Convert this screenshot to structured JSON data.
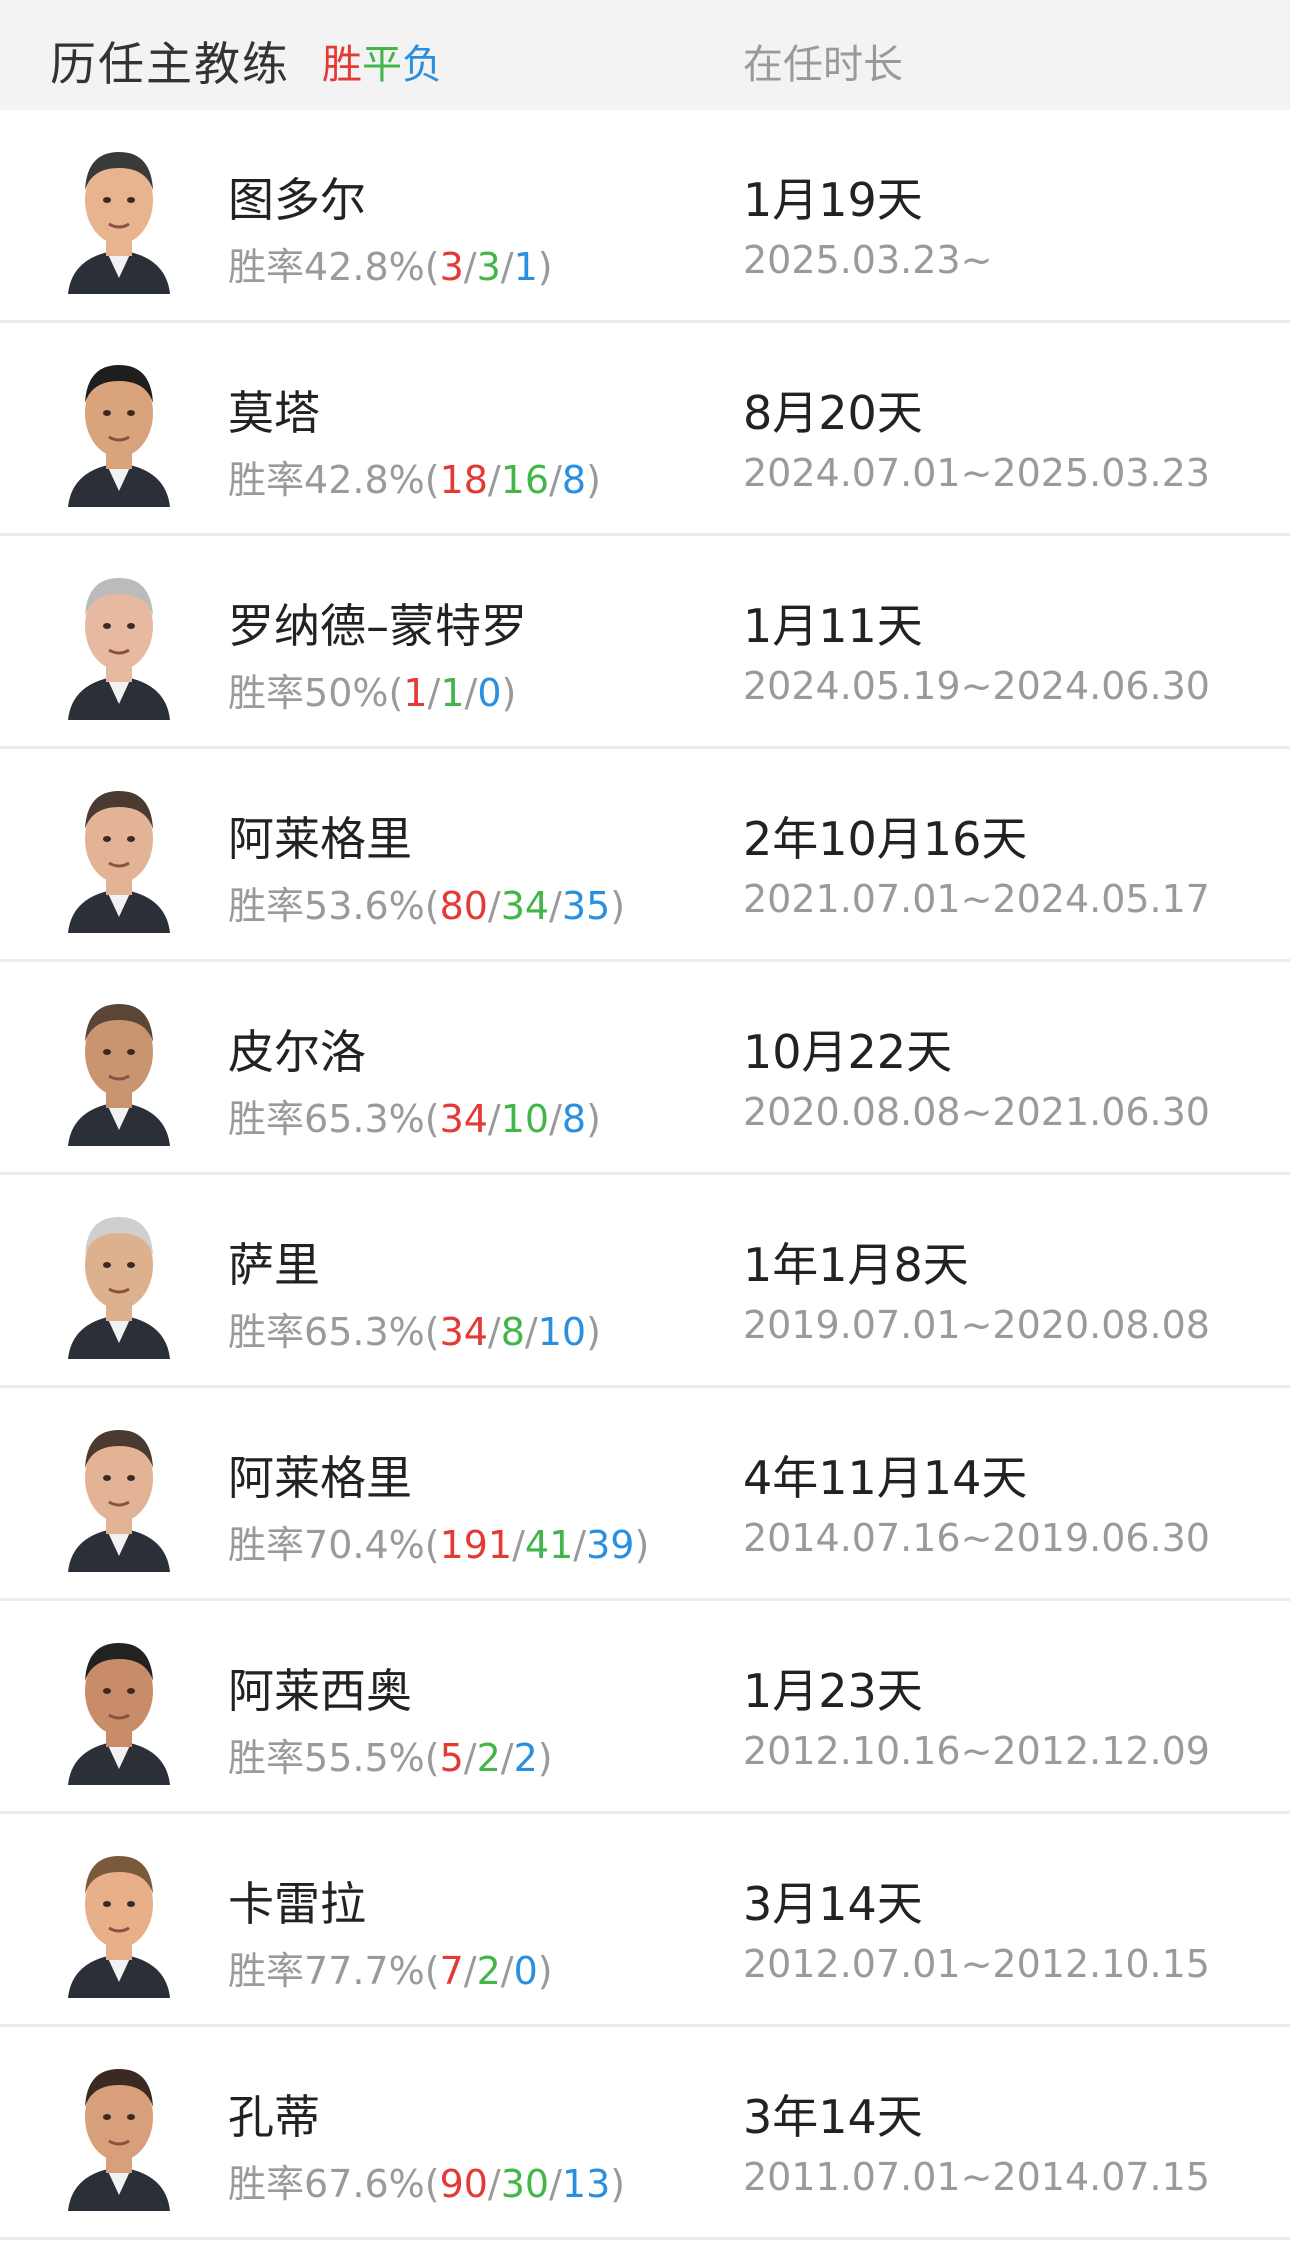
{
  "header": {
    "title": "历任主教练",
    "legend_win": "胜",
    "legend_draw": "平",
    "legend_loss": "负",
    "tenure_label": "在任时长"
  },
  "colors": {
    "win": "#e53935",
    "draw": "#43b649",
    "loss": "#2b8fe0"
  },
  "stats_prefix": "胜率",
  "coaches": [
    {
      "name": "图多尔",
      "rate": "42.8%",
      "w": "3",
      "d": "3",
      "l": "1",
      "tenure": "1月19天",
      "period": "2025.03.23~",
      "avatar": "coach-photo-icon"
    },
    {
      "name": "莫塔",
      "rate": "42.8%",
      "w": "18",
      "d": "16",
      "l": "8",
      "tenure": "8月20天",
      "period": "2024.07.01~2025.03.23",
      "avatar": "coach-photo-icon"
    },
    {
      "name": "罗纳德–蒙特罗",
      "rate": "50%",
      "w": "1",
      "d": "1",
      "l": "0",
      "tenure": "1月11天",
      "period": "2024.05.19~2024.06.30",
      "avatar": "coach-photo-icon"
    },
    {
      "name": "阿莱格里",
      "rate": "53.6%",
      "w": "80",
      "d": "34",
      "l": "35",
      "tenure": "2年10月16天",
      "period": "2021.07.01~2024.05.17",
      "avatar": "coach-photo-icon"
    },
    {
      "name": "皮尔洛",
      "rate": "65.3%",
      "w": "34",
      "d": "10",
      "l": "8",
      "tenure": "10月22天",
      "period": "2020.08.08~2021.06.30",
      "avatar": "coach-photo-icon"
    },
    {
      "name": "萨里",
      "rate": "65.3%",
      "w": "34",
      "d": "8",
      "l": "10",
      "tenure": "1年1月8天",
      "period": "2019.07.01~2020.08.08",
      "avatar": "coach-photo-icon"
    },
    {
      "name": "阿莱格里",
      "rate": "70.4%",
      "w": "191",
      "d": "41",
      "l": "39",
      "tenure": "4年11月14天",
      "period": "2014.07.16~2019.06.30",
      "avatar": "coach-photo-icon"
    },
    {
      "name": "阿莱西奥",
      "rate": "55.5%",
      "w": "5",
      "d": "2",
      "l": "2",
      "tenure": "1月23天",
      "period": "2012.10.16~2012.12.09",
      "avatar": "coach-photo-icon"
    },
    {
      "name": "卡雷拉",
      "rate": "77.7%",
      "w": "7",
      "d": "2",
      "l": "0",
      "tenure": "3月14天",
      "period": "2012.07.01~2012.10.15",
      "avatar": "coach-photo-icon"
    },
    {
      "name": "孔蒂",
      "rate": "67.6%",
      "w": "90",
      "d": "30",
      "l": "13",
      "tenure": "3年14天",
      "period": "2011.07.01~2014.07.15",
      "avatar": "coach-photo-icon"
    }
  ]
}
